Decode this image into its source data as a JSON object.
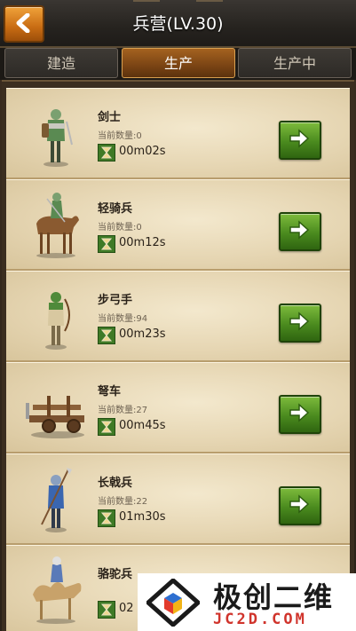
{
  "header": {
    "title": "兵营(LV.30)",
    "back_icon": "chevron-left-icon"
  },
  "tabs": [
    {
      "label": "建造",
      "active": false
    },
    {
      "label": "生产",
      "active": true
    },
    {
      "label": "生产中",
      "active": false
    }
  ],
  "units": [
    {
      "name": "剑士",
      "count_label": "当前数量:0",
      "time": "00m02s",
      "art": "swordsman"
    },
    {
      "name": "轻骑兵",
      "count_label": "当前数量:0",
      "time": "00m12s",
      "art": "light-cavalry"
    },
    {
      "name": "步弓手",
      "count_label": "当前数量:94",
      "time": "00m23s",
      "art": "archer"
    },
    {
      "name": "弩车",
      "count_label": "当前数量:27",
      "time": "00m45s",
      "art": "ballista"
    },
    {
      "name": "长戟兵",
      "count_label": "当前数量:22",
      "time": "01m30s",
      "art": "halberdier"
    },
    {
      "name": "骆驼兵",
      "count_label": "",
      "time": "02",
      "art": "camel-rider"
    }
  ],
  "watermark": {
    "title": "极创二维",
    "subtitle": "JC2D.COM"
  },
  "colors": {
    "accent_orange": "#c86c13",
    "button_green": "#4a8a1e",
    "parchment": "#e6d6b3"
  }
}
